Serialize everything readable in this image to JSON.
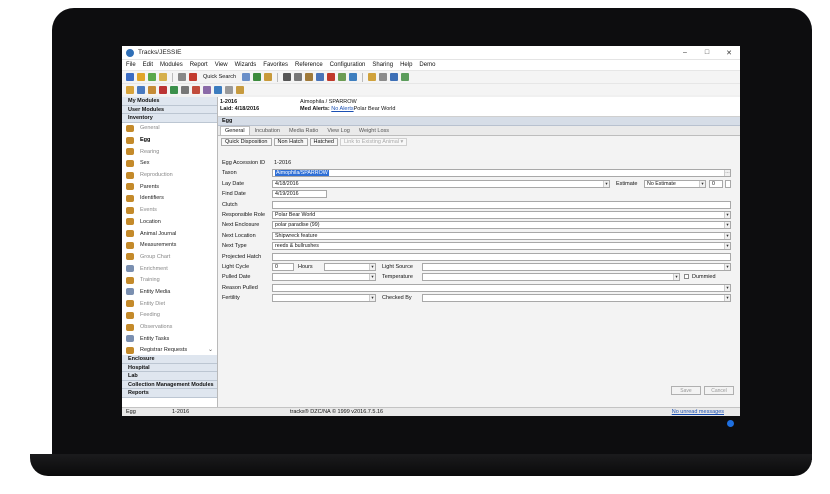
{
  "window": {
    "title": "Tracks/JESSIE",
    "minimize": "–",
    "maximize": "□",
    "close": "✕"
  },
  "menu": [
    "File",
    "Edit",
    "Modules",
    "Report",
    "View",
    "Wizards",
    "Favorites",
    "Reference",
    "Configuration",
    "Sharing",
    "Help",
    "Demo"
  ],
  "toolbar": {
    "quick_search": "Quick Search"
  },
  "sidebar": {
    "sections_top": [
      "My Modules",
      "User Modules",
      "Inventory"
    ],
    "items": [
      {
        "label": "General",
        "icon": "egg-icon",
        "state": "dim"
      },
      {
        "label": "Egg",
        "icon": "egg-icon",
        "state": "active"
      },
      {
        "label": "Rearing",
        "icon": "egg-icon",
        "state": "dim"
      },
      {
        "label": "Sex",
        "icon": "egg-icon",
        "state": "normal"
      },
      {
        "label": "Reproduction",
        "icon": "egg-icon",
        "state": "dim"
      },
      {
        "label": "Parents",
        "icon": "egg-icon",
        "state": "normal"
      },
      {
        "label": "Identifiers",
        "icon": "egg-icon",
        "state": "normal"
      },
      {
        "label": "Events",
        "icon": "egg-icon",
        "state": "dim"
      },
      {
        "label": "Location",
        "icon": "egg-icon",
        "state": "normal"
      },
      {
        "label": "Animal Journal",
        "icon": "egg-icon",
        "state": "normal"
      },
      {
        "label": "Measurements",
        "icon": "egg-icon",
        "state": "normal"
      },
      {
        "label": "Group Chart",
        "icon": "egg-icon",
        "state": "dim"
      },
      {
        "label": "Enrichment",
        "icon": "pencil-icon",
        "state": "dim"
      },
      {
        "label": "Training",
        "icon": "egg-icon",
        "state": "dim"
      },
      {
        "label": "Entity Media",
        "icon": "media-icon",
        "state": "normal"
      },
      {
        "label": "Entity Diet",
        "icon": "egg-icon",
        "state": "dim"
      },
      {
        "label": "Feeding",
        "icon": "egg-icon",
        "state": "dim"
      },
      {
        "label": "Observations",
        "icon": "egg-icon",
        "state": "dim"
      },
      {
        "label": "Entity Tasks",
        "icon": "tasks-icon",
        "state": "normal"
      },
      {
        "label": "Registrar Requests",
        "icon": "egg-icon",
        "state": "normal"
      }
    ],
    "sections_bottom": [
      "Enclosure",
      "Hospital",
      "Lab",
      "Collection Management Modules",
      "Reports"
    ]
  },
  "record": {
    "id": "1-2016",
    "laid": "Laid: 4/18/2016",
    "taxon": "Aimophila / SPARROW",
    "med_alerts_label": "Med Alerts:",
    "med_alerts_link": "No Alerts",
    "med_alerts_place": "Polar Bear World",
    "section": "Egg"
  },
  "tabs": [
    "General",
    "Incubation",
    "Media Ratio",
    "View Log",
    "Weight Loss"
  ],
  "buttons": [
    "Quick Disposition",
    "Non Hatch",
    "Hatched",
    "Link to Existing Animal ▾"
  ],
  "form": {
    "egg_accession_id": {
      "label": "Egg Accession ID",
      "value": "1-2016"
    },
    "taxon": {
      "label": "Taxon",
      "value": "Aimophila/SPARROW"
    },
    "lay_date": {
      "label": "Lay Date",
      "value": "4/18/2016"
    },
    "estimate": {
      "label": "Estimate",
      "value": "No Estimate",
      "num": "0"
    },
    "find_date": {
      "label": "Find Date",
      "value": "4/19/2016"
    },
    "clutch": {
      "label": "Clutch",
      "value": ""
    },
    "responsible_role": {
      "label": "Responsible Role",
      "value": "Polar Bear World"
    },
    "next_enclosure": {
      "label": "Next Enclosure",
      "value": "polar paradise (99)"
    },
    "next_location": {
      "label": "Next Location",
      "value": "Shipwreck feature"
    },
    "next_type": {
      "label": "Next Type",
      "value": "reeds & bullrushes"
    },
    "projected_hatch": {
      "label": "Projected Hatch",
      "value": ""
    },
    "light_cycle": {
      "label": "Light Cycle",
      "value": "0",
      "hours_label": "Hours",
      "source_label": "Light Source"
    },
    "pulled_date": {
      "label": "Pulled Date",
      "temperature_label": "Temperature",
      "dummied_label": "Dummied"
    },
    "reason_pulled": {
      "label": "Reason Pulled",
      "value": ""
    },
    "fertility": {
      "label": "Fertility",
      "checked_by_label": "Checked By"
    }
  },
  "footer_buttons": {
    "save": "Save",
    "cancel": "Cancel"
  },
  "status": {
    "left": "Egg",
    "id": "1-2016",
    "center": "tracks® DZC/NA © 1999 v2016.7.5.16",
    "right": "No unread messages"
  }
}
